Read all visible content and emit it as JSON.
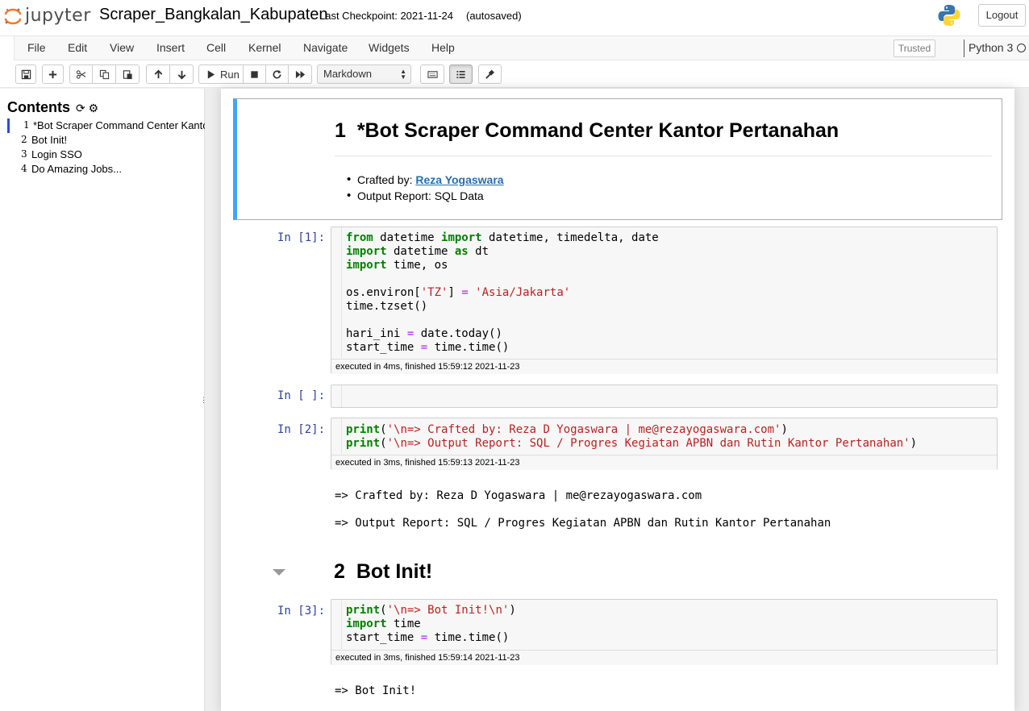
{
  "header": {
    "logo_text": "jupyter",
    "notebook_name": "Scraper_Bangkalan_Kabupaten",
    "checkpoint": "Last Checkpoint: 2021-11-24",
    "autosave": "(autosaved)",
    "logout": "Logout"
  },
  "menu": {
    "items": [
      "File",
      "Edit",
      "View",
      "Insert",
      "Cell",
      "Kernel",
      "Navigate",
      "Widgets",
      "Help"
    ],
    "trusted": "Trusted",
    "kernel": "Python 3"
  },
  "toolbar": {
    "run_label": "Run",
    "cell_type": "Markdown"
  },
  "toc": {
    "title": "Contents",
    "items": [
      {
        "num": "1",
        "label": "*Bot Scraper Command Center Kantor Pertanahan"
      },
      {
        "num": "2",
        "label": "Bot Init!"
      },
      {
        "num": "3",
        "label": "Login SSO"
      },
      {
        "num": "4",
        "label": "Do Amazing Jobs..."
      }
    ]
  },
  "notebook": {
    "md1": {
      "heading_num": "1",
      "heading": "*Bot Scraper Command Center Kantor Pertanahan",
      "bullet1_prefix": "Crafted by: ",
      "bullet1_link": "Reza Yogaswara",
      "bullet2": "Output Report: SQL Data"
    },
    "cells": [
      {
        "prompt": "In [1]:",
        "exec": "executed in 4ms, finished 15:59:12 2021-11-23"
      },
      {
        "prompt": "In [ ]:"
      },
      {
        "prompt": "In [2]:",
        "exec": "executed in 3ms, finished 15:59:13 2021-11-23",
        "out1": "=> Crafted by: Reza D Yogaswara | me@rezayogaswara.com",
        "out2": "=> Output Report: SQL / Progres Kegiatan APBN dan Rutin Kantor Pertanahan"
      },
      {
        "prompt": "In [3]:",
        "exec": "executed in 3ms, finished 15:59:14 2021-11-23",
        "out1": "=> Bot Init!"
      }
    ],
    "section2": {
      "num": "2",
      "title": "Bot Init!"
    }
  },
  "colors": {
    "selected_border": "#42a5f5",
    "prompt": "#303f9f",
    "keyword": "#008000",
    "string": "#ba2121",
    "operator": "#aa22ff"
  }
}
